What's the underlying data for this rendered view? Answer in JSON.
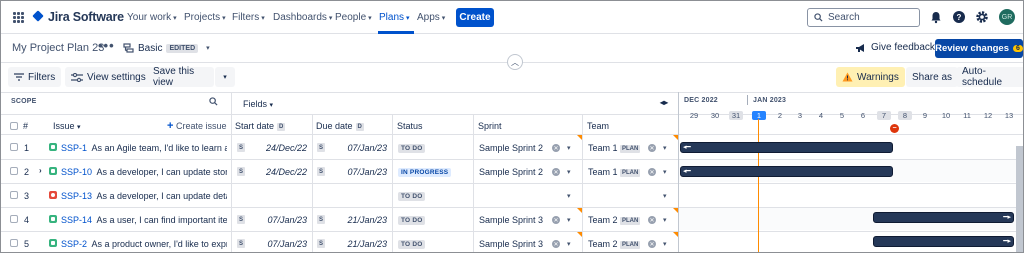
{
  "nav": {
    "product": "Jira Software",
    "items": [
      {
        "label": "Your work",
        "has_chevron": true
      },
      {
        "label": "Projects",
        "has_chevron": true
      },
      {
        "label": "Filters",
        "has_chevron": true
      },
      {
        "label": "Dashboards",
        "has_chevron": true
      },
      {
        "label": "People",
        "has_chevron": true
      },
      {
        "label": "Plans",
        "has_chevron": true,
        "active": true
      },
      {
        "label": "Apps",
        "has_chevron": true
      }
    ],
    "create_label": "Create",
    "search_placeholder": "Search",
    "avatar_initials": "GR"
  },
  "plan": {
    "title": "My Project Plan 23",
    "scenario": "Basic",
    "scenario_badge": "EDITED",
    "feedback_label": "Give feedback",
    "review_label": "Review changes",
    "review_count": "6"
  },
  "toolbar": {
    "filters": "Filters",
    "view_settings": "View settings",
    "save_view": "Save this view",
    "warnings": "Warnings",
    "share": "Share as",
    "auto_schedule": "Auto-schedule"
  },
  "table": {
    "scope_label": "SCOPE",
    "fields_label": "Fields",
    "col_num": "#",
    "col_issue": "Issue",
    "create_issue": "Create issue",
    "col_start": "Start date",
    "col_due": "Due date",
    "date_badge": "D",
    "col_status": "Status",
    "col_sprint": "Sprint",
    "col_team": "Team",
    "s_badge": "S",
    "plan_badge": "PLAN",
    "rows": [
      {
        "num": "1",
        "type": "story",
        "key": "SSP-1",
        "summary": "As an Agile team, I'd like to learn a...",
        "start": "24/Dec/22",
        "due": "07/Jan/23",
        "status": "TO DO",
        "status_kind": "todo",
        "sprint": "Sample Sprint 2",
        "team": "Team 1",
        "expand": false
      },
      {
        "num": "2",
        "type": "story",
        "key": "SSP-10",
        "summary": "As a developer, I can update story ...",
        "start": "24/Dec/22",
        "due": "07/Jan/23",
        "status": "IN PROGRESS",
        "status_kind": "prog",
        "sprint": "Sample Sprint 2",
        "team": "Team 1",
        "expand": true
      },
      {
        "num": "3",
        "type": "bug",
        "key": "SSP-13",
        "summary": "As a developer, I can update detail...",
        "start": "",
        "due": "",
        "status": "TO DO",
        "status_kind": "todo",
        "sprint": "",
        "team": "",
        "expand": false
      },
      {
        "num": "4",
        "type": "story",
        "key": "SSP-14",
        "summary": "As a user, I can find important ite...",
        "start": "07/Jan/23",
        "due": "21/Jan/23",
        "status": "TO DO",
        "status_kind": "todo",
        "sprint": "Sample Sprint 3",
        "team": "Team 2",
        "expand": false
      },
      {
        "num": "5",
        "type": "story",
        "key": "SSP-2",
        "summary": "As a product owner, I'd like to expr...",
        "start": "07/Jan/23",
        "due": "21/Jan/23",
        "status": "TO DO",
        "status_kind": "todo",
        "sprint": "Sample Sprint 3",
        "team": "Team 2",
        "expand": false
      }
    ]
  },
  "timeline": {
    "months": [
      "DEC 2022",
      "JAN 2023"
    ],
    "days": [
      "29",
      "30",
      "31",
      "1",
      "2",
      "3",
      "4",
      "5",
      "6",
      "7",
      "8",
      "9",
      "10",
      "11",
      "12",
      "13"
    ],
    "today": "1",
    "highlighted_days": [
      "31",
      "7",
      "8"
    ]
  }
}
